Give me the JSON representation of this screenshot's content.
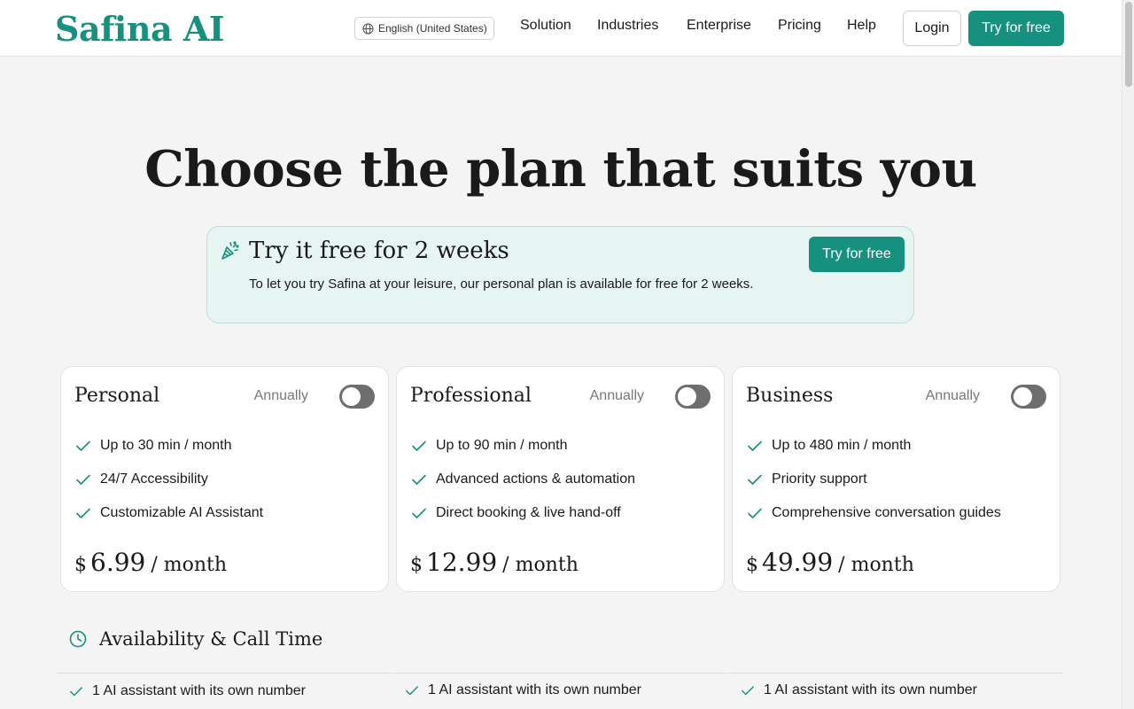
{
  "header": {
    "logo": "Safina AI",
    "language": "English (United States)",
    "nav": [
      "Solution",
      "Industries",
      "Enterprise",
      "Pricing",
      "Help"
    ],
    "login_label": "Login",
    "try_label": "Try for free"
  },
  "hero": {
    "title": "Choose the plan that suits you"
  },
  "promo": {
    "title": "Try it free for 2 weeks",
    "text": "To let you try Safina at your leisure, our personal plan is available for free for 2 weeks.",
    "button_label": "Try for free"
  },
  "plans": [
    {
      "name": "Personal",
      "toggle_label": "Annually",
      "annual_on": false,
      "features": [
        "Up to 30 min / month",
        "24/7 Accessibility",
        "Customizable AI Assistant"
      ],
      "currency": "$",
      "price": "6.99",
      "period": "/ month"
    },
    {
      "name": "Professional",
      "toggle_label": "Annually",
      "annual_on": false,
      "features": [
        "Up to 90 min / month",
        "Advanced actions & automation",
        "Direct booking & live hand-off"
      ],
      "currency": "$",
      "price": "12.99",
      "period": "/ month"
    },
    {
      "name": "Business",
      "toggle_label": "Annually",
      "annual_on": false,
      "features": [
        "Up to 480 min / month",
        "Priority support",
        "Comprehensive conversation guides"
      ],
      "currency": "$",
      "price": "49.99",
      "period": "/ month"
    }
  ],
  "availability": {
    "title": "Availability & Call Time",
    "items": [
      "1 AI assistant with its own number",
      "1 AI assistant with its own number",
      "1 AI assistant with its own number"
    ]
  },
  "colors": {
    "brand": "#16907f",
    "promo_bg": "#e6f4f2",
    "toggle_off": "#6e6e6e"
  },
  "icons": {
    "language": "globe-icon",
    "promo": "party-popper-icon",
    "feature": "check-icon",
    "section": "clock-icon"
  }
}
